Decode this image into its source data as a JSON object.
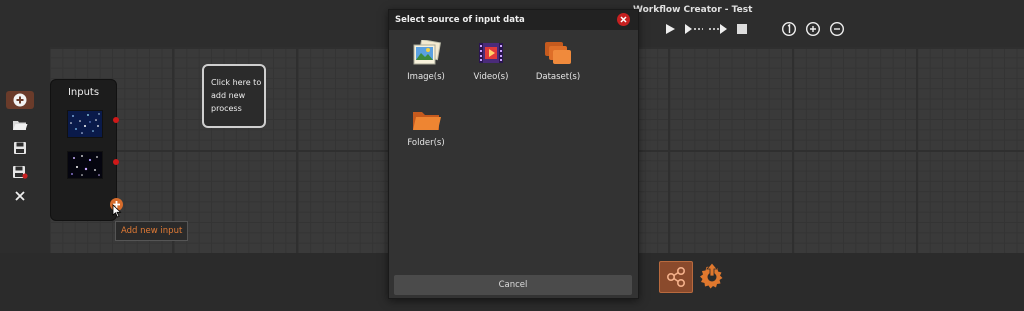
{
  "window": {
    "title": "Workflow Creator - Test"
  },
  "toolbar": {
    "buttons": [
      {
        "id": "play",
        "icon": "play-icon"
      },
      {
        "id": "step",
        "icon": "step-forward-icon"
      },
      {
        "id": "skip",
        "icon": "skip-forward-icon"
      },
      {
        "id": "stop",
        "icon": "stop-icon"
      },
      {
        "id": "zoom-reset",
        "icon": "zoom-reset-icon"
      },
      {
        "id": "zoom-in",
        "icon": "zoom-in-icon"
      },
      {
        "id": "zoom-out",
        "icon": "zoom-out-icon"
      }
    ]
  },
  "sidebar": {
    "items": [
      {
        "icon": "add-icon",
        "active": true
      },
      {
        "icon": "folder-open-icon"
      },
      {
        "icon": "save-icon"
      },
      {
        "icon": "save-as-icon"
      },
      {
        "icon": "close-icon"
      }
    ]
  },
  "inputs_node": {
    "title": "Inputs",
    "tooltip": "Add new input"
  },
  "process_placeholder": {
    "line1": "Click here to",
    "line2": "add new",
    "line3": "process"
  },
  "dialog": {
    "title": "Select source of input data",
    "options": [
      {
        "label": "Image(s)",
        "icon": "image-icon"
      },
      {
        "label": "Video(s)",
        "icon": "video-icon"
      },
      {
        "label": "Dataset(s)",
        "icon": "dataset-icon"
      },
      {
        "label": "Folder(s)",
        "icon": "folder-icon"
      }
    ],
    "cancel_label": "Cancel"
  },
  "colors": {
    "accent": "#e07a35",
    "port": "#d01818",
    "close": "#c62020",
    "background": "#2d2d2d",
    "canvas": "#3a3a3a"
  }
}
